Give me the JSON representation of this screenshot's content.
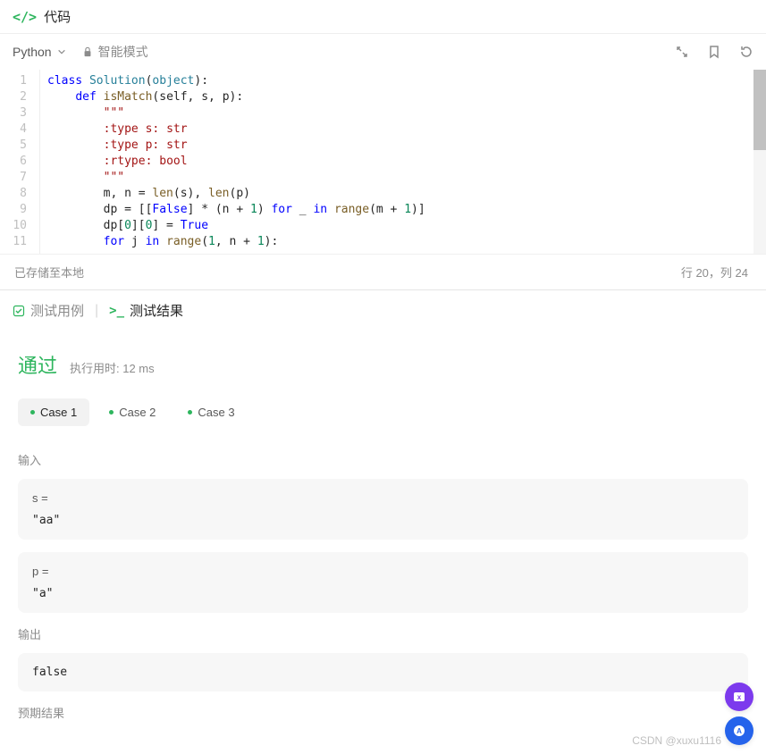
{
  "header": {
    "title": "代码"
  },
  "toolbar": {
    "language": "Python",
    "mode": "智能模式",
    "lock_tooltip": "locked"
  },
  "code": {
    "lines": [
      {
        "n": 1,
        "tokens": [
          [
            "kw",
            "class"
          ],
          [
            "",
            " "
          ],
          [
            "cls",
            "Solution"
          ],
          [
            "",
            "("
          ],
          [
            "cls",
            "object"
          ],
          [
            "",
            "):"
          ]
        ]
      },
      {
        "n": 2,
        "indent": 1,
        "tokens": [
          [
            "kw",
            "def"
          ],
          [
            "",
            " "
          ],
          [
            "fn",
            "isMatch"
          ],
          [
            "",
            "(self, s, p):"
          ]
        ]
      },
      {
        "n": 3,
        "indent": 2,
        "tokens": [
          [
            "str",
            "\"\"\""
          ]
        ]
      },
      {
        "n": 4,
        "indent": 2,
        "tokens": [
          [
            "str",
            ":type s: str"
          ]
        ]
      },
      {
        "n": 5,
        "indent": 2,
        "tokens": [
          [
            "str",
            ":type p: str"
          ]
        ]
      },
      {
        "n": 6,
        "indent": 2,
        "tokens": [
          [
            "str",
            ":rtype: bool"
          ]
        ]
      },
      {
        "n": 7,
        "indent": 2,
        "tokens": [
          [
            "str",
            "\"\"\""
          ]
        ]
      },
      {
        "n": 8,
        "indent": 2,
        "tokens": [
          [
            "",
            "m, n = "
          ],
          [
            "fn",
            "len"
          ],
          [
            "",
            "(s), "
          ],
          [
            "fn",
            "len"
          ],
          [
            "",
            "(p)"
          ]
        ]
      },
      {
        "n": 9,
        "indent": 2,
        "tokens": [
          [
            "",
            "dp = [["
          ],
          [
            "const",
            "False"
          ],
          [
            "",
            "] * (n + "
          ],
          [
            "num",
            "1"
          ],
          [
            "",
            ") "
          ],
          [
            "kw",
            "for"
          ],
          [
            "",
            " _ "
          ],
          [
            "kw",
            "in"
          ],
          [
            "",
            " "
          ],
          [
            "fn",
            "range"
          ],
          [
            "",
            "(m + "
          ],
          [
            "num",
            "1"
          ],
          [
            "",
            ")]"
          ]
        ]
      },
      {
        "n": 10,
        "indent": 2,
        "tokens": [
          [
            "",
            "dp["
          ],
          [
            "num",
            "0"
          ],
          [
            "",
            "]["
          ],
          [
            "num",
            "0"
          ],
          [
            "",
            "] = "
          ],
          [
            "const",
            "True"
          ]
        ]
      },
      {
        "n": 11,
        "indent": 2,
        "tokens": [
          [
            "kw",
            "for"
          ],
          [
            "",
            " j "
          ],
          [
            "kw",
            "in"
          ],
          [
            "",
            " "
          ],
          [
            "fn",
            "range"
          ],
          [
            "",
            "("
          ],
          [
            "num",
            "1"
          ],
          [
            "",
            ", n + "
          ],
          [
            "num",
            "1"
          ],
          [
            "",
            "):"
          ]
        ]
      }
    ]
  },
  "status": {
    "saved": "已存储至本地",
    "cursor": "行 20，列 24"
  },
  "panel": {
    "tab_cases": "测试用例",
    "tab_result": "测试结果",
    "pass": "通过",
    "runtime": "执行用时: 12 ms",
    "cases": [
      "Case 1",
      "Case 2",
      "Case 3"
    ],
    "active_case": 0,
    "input_label": "输入",
    "output_label": "输出",
    "expected_label": "预期结果",
    "inputs": [
      {
        "var": "s =",
        "val": "\"aa\""
      },
      {
        "var": "p =",
        "val": "\"a\""
      }
    ],
    "output": "false"
  },
  "watermark": "CSDN @xuxu1116"
}
